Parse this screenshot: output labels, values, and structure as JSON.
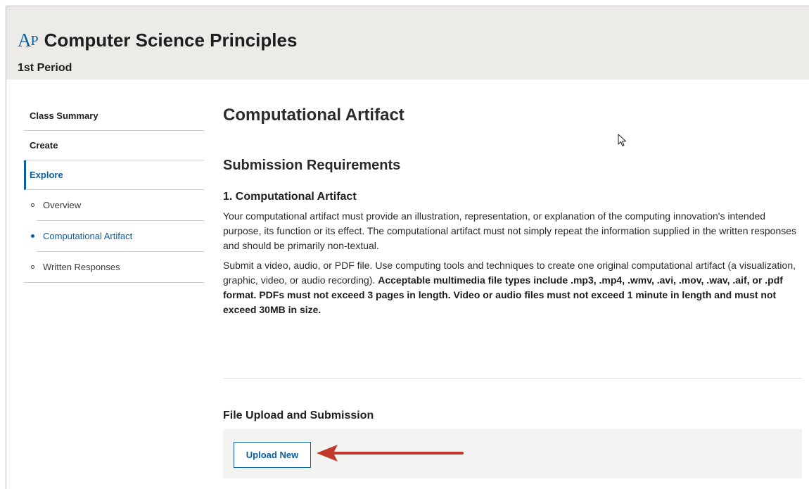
{
  "header": {
    "logo_text": "AP",
    "title": "Computer Science Principles",
    "subtitle": "1st Period"
  },
  "sidebar": {
    "items": [
      {
        "label": "Class Summary"
      },
      {
        "label": "Create"
      },
      {
        "label": "Explore"
      }
    ],
    "sub_items": [
      {
        "label": "Overview"
      },
      {
        "label": "Computational Artifact"
      },
      {
        "label": "Written Responses"
      }
    ],
    "active_item": "Explore",
    "active_sub_item": "Computational Artifact"
  },
  "main": {
    "page_title": "Computational Artifact",
    "section_title": "Submission Requirements",
    "requirement_title": "1. Computational Artifact",
    "paragraph1": "Your computational artifact must provide an illustration, representation, or explanation of the computing innovation's intended purpose, its function or its effect. The computational artifact must not simply repeat the information supplied in the written responses and should be primarily non-textual.",
    "paragraph2_plain": "Submit a video, audio, or PDF file. Use computing tools and techniques to create one original computational artifact (a visualization, graphic, video, or audio recording).",
    "paragraph2_bold": "Acceptable multimedia file types include .mp3, .mp4, .wmv, .avi, .mov, .wav, .aif, or .pdf format. PDFs must not exceed 3 pages in length. Video or audio files must not exceed 1 minute in length and must not exceed 30MB in size."
  },
  "upload": {
    "title": "File Upload and Submission",
    "button_label": "Upload New"
  },
  "colors": {
    "accent": "#0b5fa3",
    "header_bg": "#ecebe8",
    "annotation_arrow": "#c0392b"
  },
  "icons": {
    "annotation": "red-arrow-icon",
    "cursor": "mouse-pointer-icon"
  }
}
